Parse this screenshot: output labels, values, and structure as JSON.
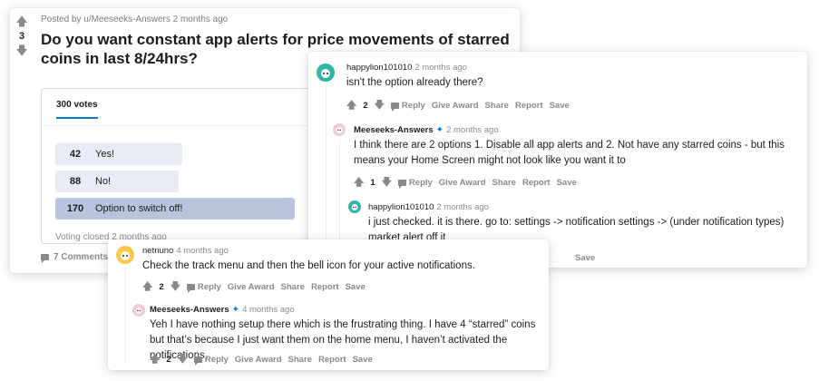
{
  "post": {
    "score": "3",
    "posted_by": "Posted by u/Meeseeks-Answers 2 months ago",
    "title": "Do you want constant app alerts for price movements of starred coins in last 8/24hrs?",
    "poll": {
      "votes_label": "300 votes",
      "options": [
        {
          "count": "42",
          "label": "Yes!",
          "fraction": 0.14
        },
        {
          "count": "88",
          "label": "No!",
          "fraction": 0.29
        },
        {
          "count": "170",
          "label": "Option to switch off!",
          "fraction": 0.57
        }
      ],
      "footer": "Voting closed 2 months ago"
    },
    "comments_label": "7 Comments"
  },
  "thread1": {
    "c1": {
      "user": "happylion101010",
      "time": "2 months ago",
      "text": "isn't the option already there?",
      "score": "2"
    },
    "c2": {
      "user": "Meeseeks-Answers",
      "time": "2 months ago",
      "text": "I think there are 2 options 1. Disable all app alerts and 2. Not have any starred coins - but this means your Home Screen might not look like you want it to",
      "score": "1"
    },
    "c3": {
      "user": "happylion101010",
      "time": "2 months ago",
      "text": "i just checked. it is there. go to: settings -> notification settings -> (under notification types) market alert off it"
    },
    "save_peek": "Save"
  },
  "thread2": {
    "c1": {
      "user": "netnuno",
      "time": "4 months ago",
      "text": "Check the track menu and then the bell icon for your active notifications.",
      "score": "2"
    },
    "c2": {
      "user": "Meeseeks-Answers",
      "time": "4 months ago",
      "text": "Yeh I have nothing setup there which is the frustrating thing. I have 4 “starred” coins but that’s because I just want them on the home menu, I haven’t activated the notifications…",
      "score": "2"
    }
  },
  "actions": {
    "reply": "Reply",
    "give_award": "Give Award",
    "share": "Share",
    "report": "Report",
    "save": "Save"
  },
  "colors": {
    "accent": "#0079d3",
    "poll_bar": "#e8ebf3",
    "poll_winner": "#b8c4dd",
    "meta_gray": "#878a8c"
  },
  "icons": [
    "upvote-icon",
    "downvote-icon",
    "chat-icon",
    "snoo-avatar-icon",
    "moderator-wand-icon"
  ]
}
